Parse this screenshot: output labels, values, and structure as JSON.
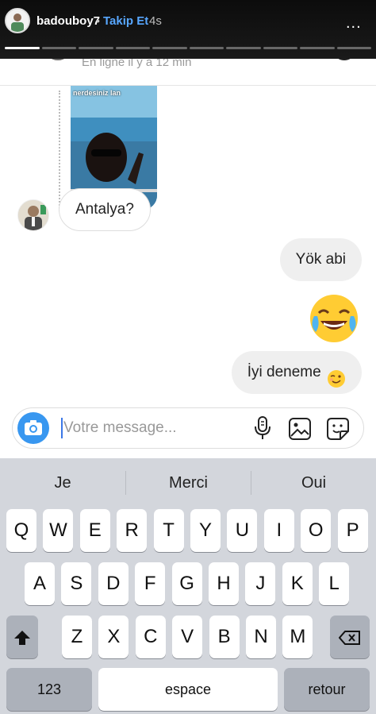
{
  "story": {
    "username": "badouboy7",
    "separator": "•",
    "follow_label": "Takip Et",
    "time": "4s",
    "more": "...",
    "segments_total": 10,
    "segments_watched": 1
  },
  "chat": {
    "status": "En ligne il y a 12 min",
    "photo_caption": "nerdesiniz lan",
    "messages": [
      {
        "from": "them",
        "text": "Antalya?"
      },
      {
        "from": "me",
        "text": "Yök abi"
      },
      {
        "from": "me",
        "emoji": "joy-emoji"
      },
      {
        "from": "me",
        "text": "İyi deneme",
        "emoji": "wink-emoji"
      }
    ]
  },
  "composer": {
    "placeholder": "Votre message...",
    "value": ""
  },
  "keyboard": {
    "suggestions": [
      "Je",
      "Merci",
      "Oui"
    ],
    "row1": [
      "Q",
      "W",
      "E",
      "R",
      "T",
      "Y",
      "U",
      "I",
      "O",
      "P"
    ],
    "row2": [
      "A",
      "S",
      "D",
      "F",
      "G",
      "H",
      "J",
      "K",
      "L"
    ],
    "row3": [
      "Z",
      "X",
      "C",
      "V",
      "B",
      "N",
      "M"
    ],
    "numbers_key": "123",
    "space_key": "espace",
    "return_key": "retour"
  },
  "colors": {
    "accent": "#3897f0",
    "follow": "#58a7ff",
    "keyboard_bg": "#d3d6dc"
  }
}
